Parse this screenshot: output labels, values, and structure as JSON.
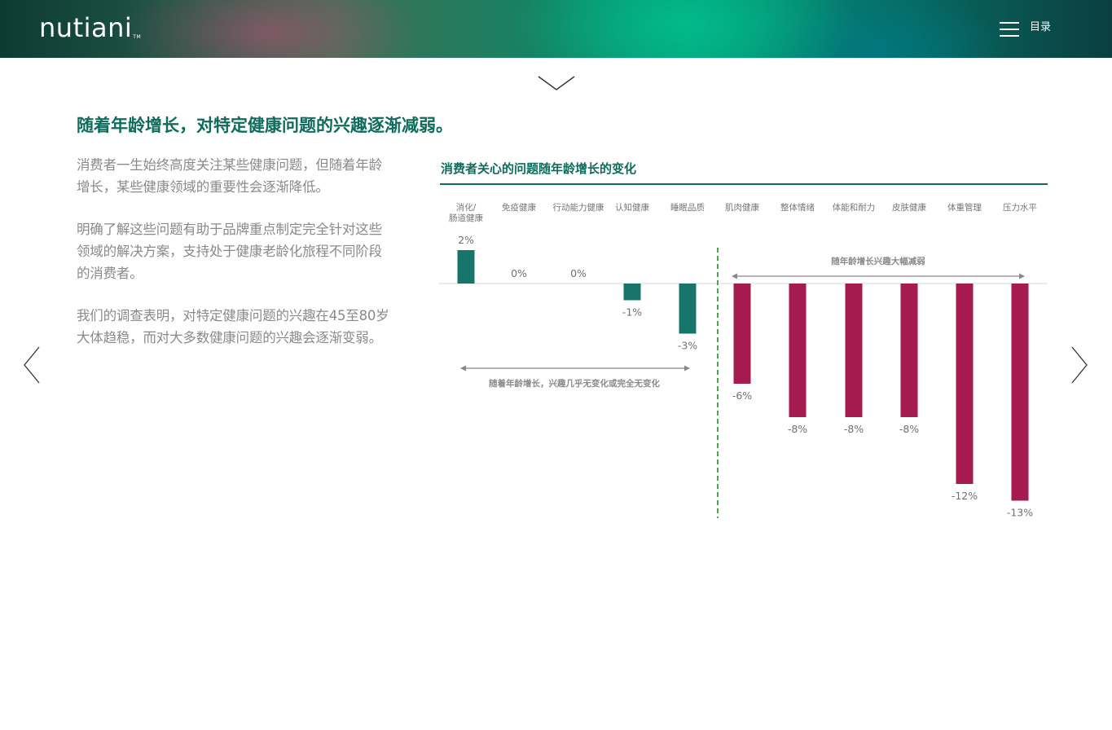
{
  "header": {
    "logo_text": "nutiani",
    "logo_tm": "TM",
    "menu_label": "目录"
  },
  "main": {
    "heading": "随着年龄增长，对特定健康问题的兴趣逐渐减弱。",
    "paragraphs": [
      "消费者一生始终高度关注某些健康问题，但随着年龄增长，某些健康领域的重要性会逐渐降低。",
      "明确了解这些问题有助于品牌重点制定完全针对这些领域的解决方案，支持处于健康老龄化旅程不同阶段的消费者。",
      "我们的调查表明，对特定健康问题的兴趣在45至80岁大体趋稳，而对大多数健康问题的兴趣会逐渐变弱。"
    ]
  },
  "chart_data": {
    "type": "bar",
    "title": "消费者关心的问题随年龄增长的变化",
    "categories": [
      "消化/\n肠道健康",
      "免疫健康",
      "行动能力健康",
      "认知健康",
      "睡眠品质",
      "肌肉健康",
      "整体情绪",
      "体能和耐力",
      "皮肤健康",
      "体重管理",
      "压力水平"
    ],
    "values": [
      2,
      0,
      0,
      -1,
      -3,
      -6,
      -8,
      -8,
      -8,
      -12,
      -13
    ],
    "value_labels": [
      "2%",
      "0%",
      "0%",
      "-1%",
      "-3%",
      "-6%",
      "-8%",
      "-8%",
      "-8%",
      "-12%",
      "-13%"
    ],
    "unit": "%",
    "groups": [
      {
        "label": "随着年龄增长，兴趣几乎无变化或完全无变化",
        "categories": [
          "消化/\n肠道健康",
          "免疫健康",
          "行动能力健康",
          "认知健康",
          "睡眠品质"
        ],
        "color": "#17756b"
      },
      {
        "label": "随年龄增长兴趣大幅减弱",
        "categories": [
          "肌肉健康",
          "整体情绪",
          "体能和耐力",
          "皮肤健康",
          "体重管理",
          "压力水平"
        ],
        "color": "#a51a4f"
      }
    ],
    "divider_color": "#4aa84a",
    "xlabel": "",
    "ylabel": "",
    "grid": false,
    "legend": "none"
  }
}
